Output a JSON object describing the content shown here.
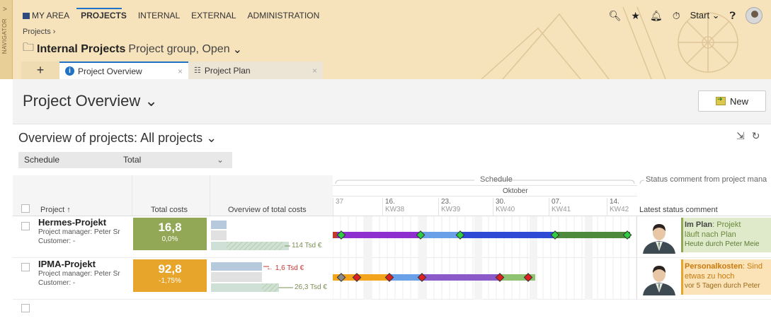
{
  "navigator": {
    "label": "NAVIGATOR",
    "arrow": ">"
  },
  "menu": {
    "items": [
      {
        "label": "MY AREA",
        "active": false
      },
      {
        "label": "PROJECTS",
        "active": true
      },
      {
        "label": "INTERNAL",
        "active": false
      },
      {
        "label": "EXTERNAL",
        "active": false
      },
      {
        "label": "ADMINISTRATION",
        "active": false
      }
    ]
  },
  "breadcrumb": "Projects ›",
  "group": {
    "title": "Internal Projects",
    "subtitle": "Project group, Open",
    "chevron": "⌄"
  },
  "top_right": {
    "start_label": "Start ⌄",
    "icons": [
      "search-icon",
      "star-icon",
      "bell-icon",
      "timer-icon",
      "help-icon",
      "avatar"
    ]
  },
  "tabs": {
    "add": "+",
    "items": [
      {
        "label": "Project Overview",
        "icon": "info-icon",
        "close": "×",
        "active": true
      },
      {
        "label": "Project Plan",
        "icon": "plan-icon",
        "close": "×",
        "active": false
      }
    ]
  },
  "page": {
    "title": "Project Overview ⌄",
    "new_label": "New"
  },
  "panel": {
    "title": "Overview of projects: All projects ⌄",
    "filter": {
      "left": "Schedule",
      "right": "Total",
      "chevron": "⌄"
    }
  },
  "table": {
    "headers": {
      "project": "Project ↑",
      "total_costs": "Total costs",
      "overview_costs": "Overview of total costs",
      "schedule": "Schedule",
      "month": "Oktober",
      "status_group": "Status comment from project mana",
      "latest_status": "Latest status comment"
    },
    "weeks": [
      {
        "day": "",
        "kw": "37"
      },
      {
        "day": "16.",
        "kw": "KW38"
      },
      {
        "day": "23.",
        "kw": "KW39"
      },
      {
        "day": "30.",
        "kw": "KW40"
      },
      {
        "day": "07.",
        "kw": "KW41"
      },
      {
        "day": "14.",
        "kw": "KW42"
      }
    ],
    "rows": [
      {
        "name": "Hermes-Projekt",
        "manager": "Project manager:  Peter Sr",
        "customer": "Customer:  -",
        "cost_value": "16,8",
        "cost_delta": "0,0%",
        "cost_color": "#93a857",
        "overview_label": "114 Tsd €",
        "status_headline": "Im Plan",
        "status_text": ": Projekt läuft nach Plan",
        "status_line2": "läuft nach Plan",
        "status_meta": "Heute  durch Peter Meie",
        "status_color": "#dfeacb"
      },
      {
        "name": "IPMA-Projekt",
        "manager": "Project manager:  Peter Sr",
        "customer": "Customer:  -",
        "cost_value": "92,8",
        "cost_delta": "-1,75%",
        "cost_color": "#e8a52c",
        "overview_label_top": "1,6 Tsd €",
        "overview_label": "26,3 Tsd €",
        "status_headline": "Personalkosten",
        "status_text": ": Sind",
        "status_line2": "etwas zu hoch",
        "status_meta": "vor 5 Tagen  durch Peter",
        "status_color": "#fbe2b7"
      }
    ]
  },
  "colors": {
    "header_bg": "#f6e3bc",
    "accent": "#1f72c4",
    "bar_purple": "#8e2fd0",
    "bar_blue": "#2f4bd6",
    "bar_lightblue": "#6aa0e8",
    "bar_green": "#4e8a3c",
    "bar_orange": "#f2a51c",
    "bar_lightgreen": "#8fc271"
  }
}
